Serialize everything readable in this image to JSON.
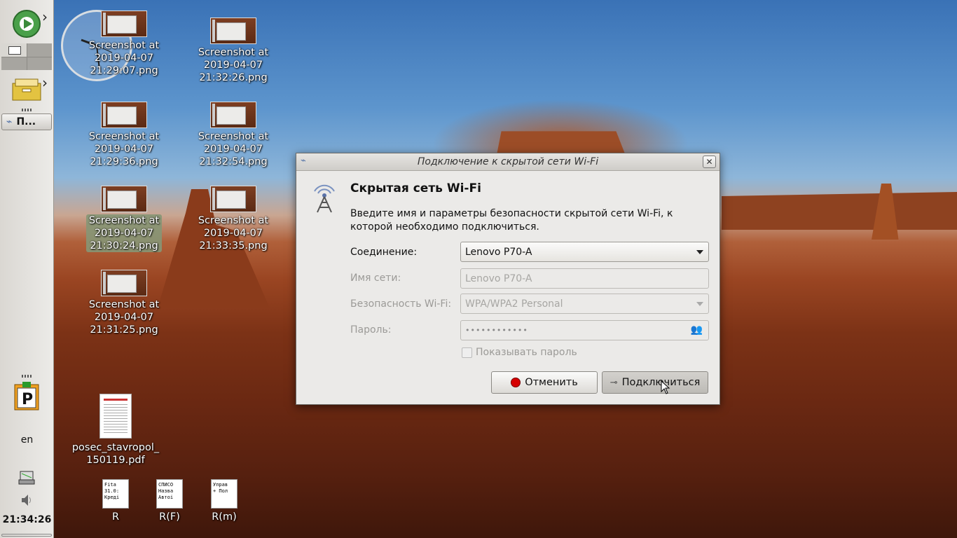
{
  "sidebar": {
    "task_label": "П...",
    "lang": "en",
    "time": "21:34:26"
  },
  "desktop_icons": [
    {
      "name": "Screenshot at\n2019-04-07\n21:29:07.png"
    },
    {
      "name": "Screenshot at\n2019-04-07\n21:29:36.png"
    },
    {
      "name": "Screenshot at\n2019-04-07\n21:30:24.png"
    },
    {
      "name": "Screenshot at\n2019-04-07\n21:31:25.png"
    },
    {
      "name": "Screenshot at\n2019-04-07\n21:32:26.png"
    },
    {
      "name": "Screenshot at\n2019-04-07\n21:32:54.png"
    },
    {
      "name": "Screenshot at\n2019-04-07\n21:33:35.png"
    },
    {
      "name": "posec_stavropol_\n150119.pdf"
    },
    {
      "name": "R",
      "preview": "Fita\n31.0:\nКреді"
    },
    {
      "name": "R(F)",
      "preview": "СПИСО\nНазва\nАвтоі"
    },
    {
      "name": "R(m)",
      "preview": "Управ\n+ Пол"
    }
  ],
  "dialog": {
    "title": "Подключение к скрытой сети Wi-Fi",
    "heading": "Скрытая сеть Wi-Fi",
    "description": "Введите имя и параметры безопасности скрытой сети Wi-Fi, к которой необходимо подключиться.",
    "connection_label": "Соединение:",
    "connection_value": "Lenovo P70-A",
    "ssid_label": "Имя сети:",
    "ssid_value": "Lenovo P70-A",
    "security_label": "Безопасность Wi-Fi:",
    "security_value": "WPA/WPA2 Personal",
    "password_label": "Пароль:",
    "password_value": "••••••••••••",
    "show_password_label": "Показывать пароль",
    "cancel_label": "Отменить",
    "connect_label": "Подключиться"
  },
  "colors": {
    "dialog_bg": "#ebeae8",
    "cancel_icon": "#d60000"
  }
}
